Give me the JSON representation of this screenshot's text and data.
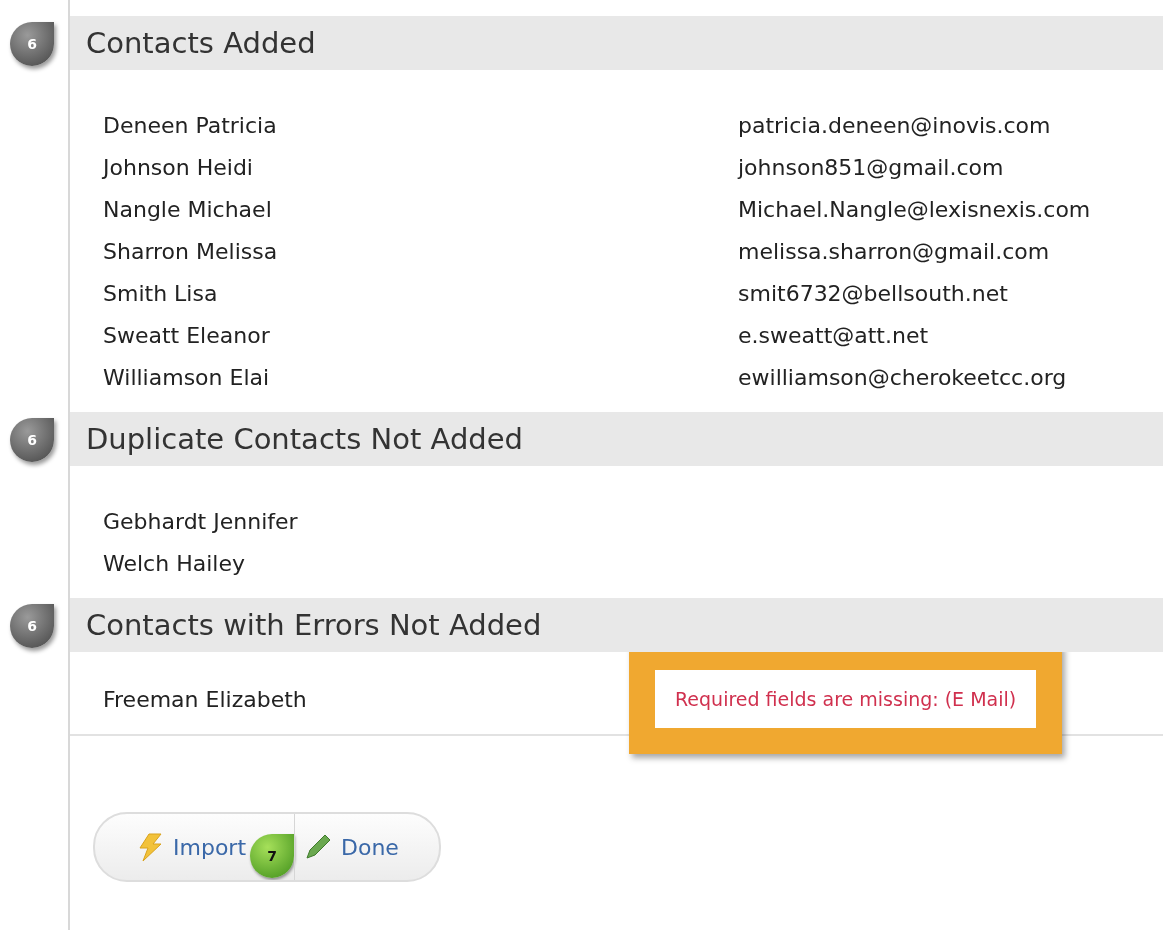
{
  "sections": [
    {
      "title": "Contacts Added",
      "marker": "6",
      "contacts": [
        {
          "name": "Deneen Patricia",
          "email": "patricia.deneen@inovis.com"
        },
        {
          "name": "Johnson Heidi",
          "email": "johnson851@gmail.com"
        },
        {
          "name": "Nangle Michael",
          "email": "Michael.Nangle@lexisnexis.com"
        },
        {
          "name": "Sharron Melissa",
          "email": "melissa.sharron@gmail.com"
        },
        {
          "name": "Smith Lisa",
          "email": "smit6732@bellsouth.net"
        },
        {
          "name": "Sweatt Eleanor",
          "email": "e.sweatt@att.net"
        },
        {
          "name": "Williamson Elai",
          "email": "ewilliamson@cherokeetcc.org"
        }
      ]
    },
    {
      "title": "Duplicate Contacts Not Added",
      "marker": "6",
      "contacts": [
        {
          "name": "Gebhardt Jennifer"
        },
        {
          "name": "Welch Hailey"
        }
      ]
    },
    {
      "title": "Contacts with Errors Not Added",
      "marker": "6",
      "contacts": [
        {
          "name": "Freeman Elizabeth",
          "error": "Required fields are missing: (E Mail)",
          "highlighted": true
        }
      ]
    }
  ],
  "buttons": [
    {
      "label": "Import",
      "kind": "import"
    },
    {
      "label": "Done",
      "kind": "done"
    }
  ],
  "button_marker": "7"
}
